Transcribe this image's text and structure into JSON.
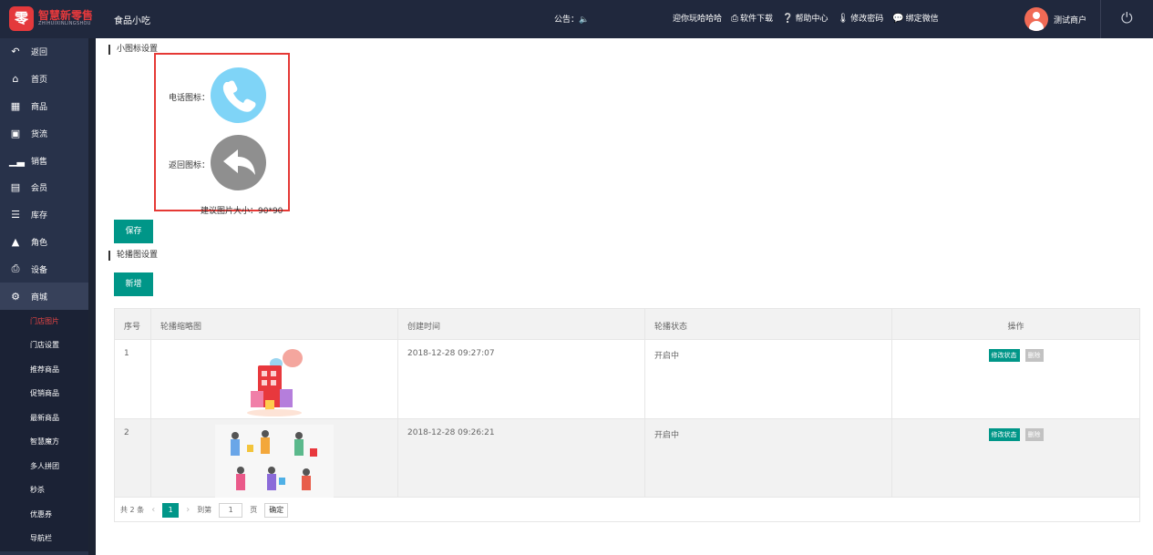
{
  "header": {
    "logo_mark": "零",
    "logo_title": "智慧新零售",
    "logo_subtitle": "ZHIHUIXINLINGSHOU",
    "store_name": "食品小吃",
    "notice_label": "公告：",
    "links": [
      {
        "label": "迎你玩哈哈哈",
        "icon": ""
      },
      {
        "label": "软件下载",
        "icon": "print-icon"
      },
      {
        "label": "帮助中心",
        "icon": "help-icon"
      },
      {
        "label": "修改密码",
        "icon": "thermometer-icon"
      },
      {
        "label": "绑定微信",
        "icon": "wechat-icon"
      }
    ],
    "username": "测试商户"
  },
  "sidebar": {
    "items": [
      {
        "label": "返回",
        "icon": "back-icon"
      },
      {
        "label": "首页",
        "icon": "home-icon"
      },
      {
        "label": "商品",
        "icon": "grid-icon"
      },
      {
        "label": "货流",
        "icon": "truck-icon"
      },
      {
        "label": "销售",
        "icon": "bar-chart-icon"
      },
      {
        "label": "会员",
        "icon": "id-card-icon"
      },
      {
        "label": "库存",
        "icon": "database-icon"
      },
      {
        "label": "角色",
        "icon": "user-icon"
      },
      {
        "label": "设备",
        "icon": "printer-icon"
      },
      {
        "label": "商城",
        "icon": "gear-icon"
      }
    ],
    "subitems": [
      "门店图片",
      "门店设置",
      "推荐商品",
      "促销商品",
      "最新商品",
      "智慧魔方",
      "多人拼团",
      "秒杀",
      "优惠券",
      "导航栏"
    ],
    "active_subitem": "门店图片"
  },
  "small_icons": {
    "title": "小图标设置",
    "phone_label": "电话图标：",
    "back_label": "返回图标：",
    "hint": "建议图片大小：90*90",
    "save_label": "保存",
    "phone_color": "#7fd4f7",
    "back_color": "#8f8f8f"
  },
  "carousel": {
    "title": "轮播图设置",
    "add_label": "新增",
    "columns": [
      "序号",
      "轮播缩略图",
      "创建时间",
      "轮播状态",
      "操作"
    ],
    "rows": [
      {
        "index": "1",
        "time": "2018-12-28 09:27:07",
        "status": "开启中",
        "edit": "修改状态",
        "delete": "删除"
      },
      {
        "index": "2",
        "time": "2018-12-28 09:26:21",
        "status": "开启中",
        "edit": "修改状态",
        "delete": "删除"
      }
    ],
    "pager": {
      "total": "共 2 条",
      "current": "1",
      "goto": "到第",
      "page_value": "1",
      "page_unit": "页",
      "confirm": "确定"
    }
  },
  "colors": {
    "accent": "#009688",
    "header": "#20283d",
    "sidebar": "#28324a",
    "danger": "#e53935"
  }
}
